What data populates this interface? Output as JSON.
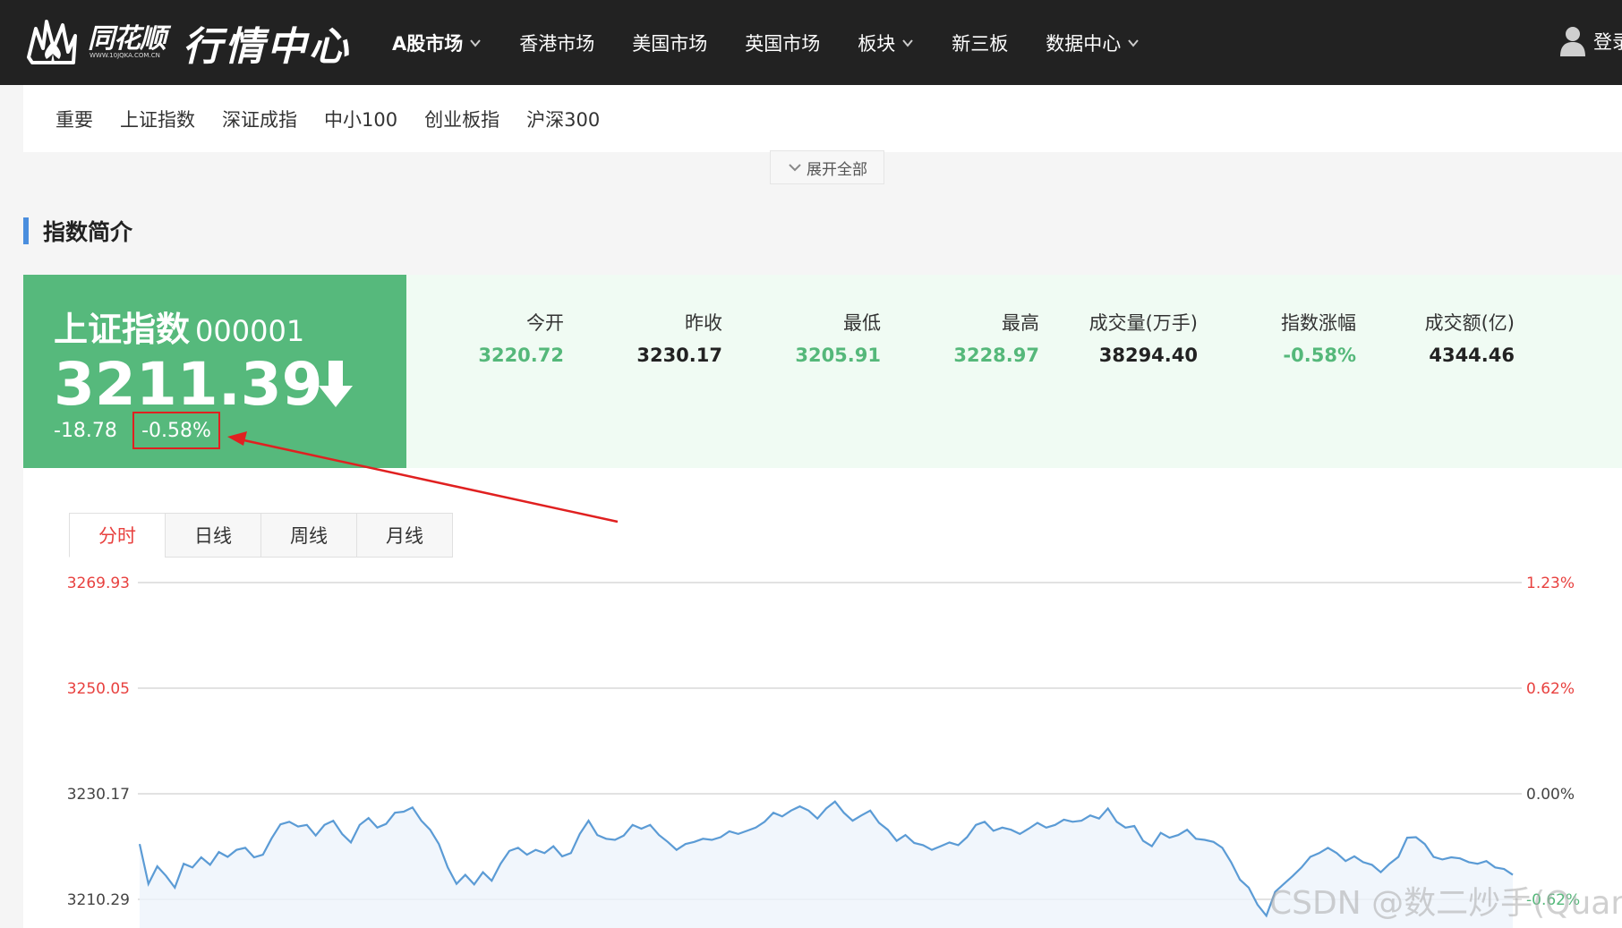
{
  "header": {
    "logo_brand": "同花顺",
    "logo_url": "WWW.10JQKA.COM.CN",
    "logo_title": "行情中心",
    "nav": [
      {
        "label": "A股市场",
        "dropdown": true,
        "bold": true
      },
      {
        "label": "香港市场",
        "dropdown": false,
        "bold": false
      },
      {
        "label": "美国市场",
        "dropdown": false,
        "bold": false
      },
      {
        "label": "英国市场",
        "dropdown": false,
        "bold": false
      },
      {
        "label": "板块",
        "dropdown": true,
        "bold": false
      },
      {
        "label": "新三板",
        "dropdown": false,
        "bold": false
      },
      {
        "label": "数据中心",
        "dropdown": true,
        "bold": false
      }
    ],
    "login_label": "登录"
  },
  "index_tabs": [
    "重要",
    "上证指数",
    "深证成指",
    "中小100",
    "创业板指",
    "沪深300"
  ],
  "expand_label": "展开全部",
  "section_title": "指数简介",
  "index_card": {
    "name": "上证指数",
    "code": "000001",
    "price": "3211.39",
    "change": "-18.78",
    "change_pct": "-0.58%",
    "direction_icon": "arrow-down-icon",
    "stats": [
      {
        "label": "今开",
        "value": "3220.72",
        "color": "green"
      },
      {
        "label": "昨收",
        "value": "3230.17",
        "color": "dark"
      },
      {
        "label": "最低",
        "value": "3205.91",
        "color": "green"
      },
      {
        "label": "最高",
        "value": "3228.97",
        "color": "green"
      },
      {
        "label": "成交量(万手)",
        "value": "38294.40",
        "color": "dark"
      },
      {
        "label": "指数涨幅",
        "value": "-0.58%",
        "color": "green"
      },
      {
        "label": "成交额(亿)",
        "value": "4344.46",
        "color": "dark"
      }
    ]
  },
  "chart_tabs": [
    {
      "label": "分时",
      "active": true
    },
    {
      "label": "日线",
      "active": false
    },
    {
      "label": "周线",
      "active": false
    },
    {
      "label": "月线",
      "active": false
    }
  ],
  "colors": {
    "topbar": "#222222",
    "card_green": "#56b97c",
    "up_red": "#e8413f",
    "down_green": "#55b87a",
    "line_blue": "#5b9bd5",
    "highlight_box": "#e02020"
  },
  "chart_data": {
    "type": "line",
    "title": "",
    "prev_close": 3230.17,
    "y_ticks_left": [
      "3269.93",
      "3250.05",
      "3230.17",
      "3210.29"
    ],
    "y_ticks_right": [
      "1.23%",
      "0.62%",
      "0.00%",
      "-0.62%"
    ],
    "ylim": [
      3210.29,
      3269.93
    ],
    "series": [
      {
        "values": [
          3220.7,
          3213.2,
          3216.5,
          3214.7,
          3212.5,
          3217.0,
          3216.3,
          3218.2,
          3216.8,
          3219.2,
          3218.3,
          3219.6,
          3220.0,
          3218.2,
          3218.7,
          3221.8,
          3224.4,
          3224.9,
          3224.0,
          3224.3,
          3222.3,
          3224.3,
          3225.1,
          3222.6,
          3221.0,
          3224.3,
          3225.6,
          3223.8,
          3224.5,
          3226.6,
          3226.8,
          3227.6,
          3225.1,
          3223.4,
          3220.7,
          3216.3,
          3213.2,
          3214.9,
          3213.1,
          3215.4,
          3213.8,
          3217.0,
          3219.4,
          3220.0,
          3218.7,
          3219.6,
          3219.0,
          3220.3,
          3218.4,
          3219.0,
          3222.6,
          3225.1,
          3222.4,
          3221.7,
          3221.5,
          3222.3,
          3224.3,
          3223.6,
          3224.3,
          3222.4,
          3221.1,
          3219.6,
          3220.7,
          3221.1,
          3221.7,
          3221.5,
          3222.0,
          3223.1,
          3222.6,
          3223.2,
          3223.8,
          3224.9,
          3226.6,
          3225.9,
          3227.0,
          3227.8,
          3227.0,
          3225.5,
          3227.4,
          3228.7,
          3226.6,
          3225.1,
          3226.1,
          3227.0,
          3224.7,
          3223.4,
          3221.3,
          3222.4,
          3220.9,
          3220.5,
          3219.6,
          3220.3,
          3221.0,
          3220.5,
          3222.0,
          3224.3,
          3224.9,
          3223.2,
          3223.8,
          3223.4,
          3222.6,
          3223.6,
          3224.7,
          3223.8,
          3224.3,
          3225.3,
          3224.9,
          3225.1,
          3226.1,
          3225.5,
          3227.4,
          3224.9,
          3223.8,
          3224.1,
          3221.3,
          3220.3,
          3222.8,
          3221.9,
          3222.4,
          3223.4,
          3221.7,
          3221.5,
          3221.1,
          3220.0,
          3217.3,
          3214.0,
          3212.5,
          3209.3,
          3207.2,
          3211.7,
          3213.2,
          3214.7,
          3216.3,
          3218.3,
          3219.0,
          3220.0,
          3219.0,
          3217.5,
          3218.4,
          3217.3,
          3216.8,
          3215.4,
          3217.0,
          3218.3,
          3221.9,
          3222.0,
          3220.7,
          3218.3,
          3217.8,
          3218.2,
          3218.0,
          3217.3,
          3217.0,
          3217.5,
          3216.3,
          3216.0,
          3214.9
        ]
      }
    ],
    "grid": true,
    "annotations": []
  },
  "watermark": "CSDN @数二炒手(Quant)"
}
